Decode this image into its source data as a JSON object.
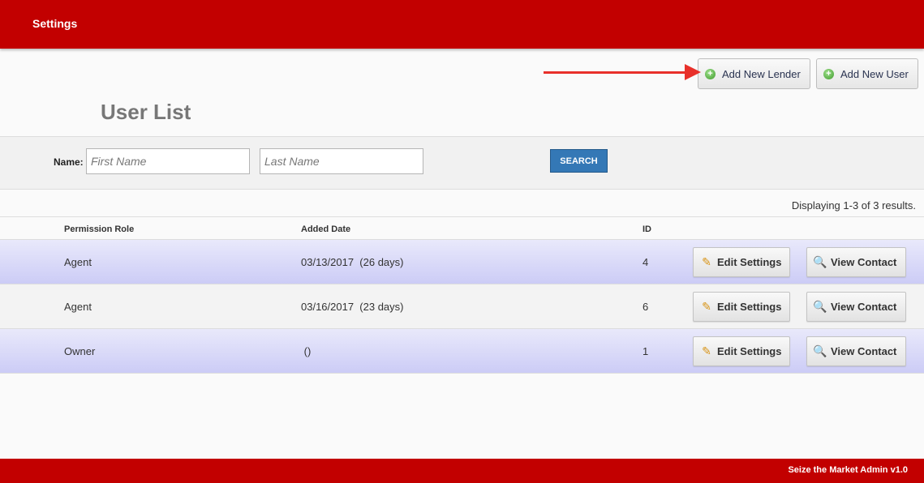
{
  "header": {
    "title": "Settings"
  },
  "toolbar": {
    "add_lender_label": "Add New Lender",
    "add_user_label": "Add New User"
  },
  "colors": {
    "brand": "#c20000",
    "accent": "#3478b6",
    "arrow": "#e8302a"
  },
  "page_title": "User List",
  "search": {
    "name_label": "Name:",
    "first_placeholder": "First Name",
    "last_placeholder": "Last Name",
    "button_label": "SEARCH"
  },
  "results_text": "Displaying 1-3 of 3 results.",
  "table": {
    "columns": [
      "Permission Role",
      "Added Date",
      "ID"
    ],
    "rows": [
      {
        "role": "Agent",
        "date": "03/13/2017  (26 days)",
        "id": "4"
      },
      {
        "role": "Agent",
        "date": "03/16/2017  (23 days)",
        "id": "6"
      },
      {
        "role": "Owner",
        "date": " ()",
        "id": "1"
      }
    ],
    "edit_label": "Edit Settings",
    "view_label": "View Contact"
  },
  "icons": {
    "add": "plus-circle-icon",
    "edit": "pencil-icon",
    "view": "magnifier-icon"
  },
  "footer": {
    "version_text": "Seize the Market Admin v1.0"
  }
}
